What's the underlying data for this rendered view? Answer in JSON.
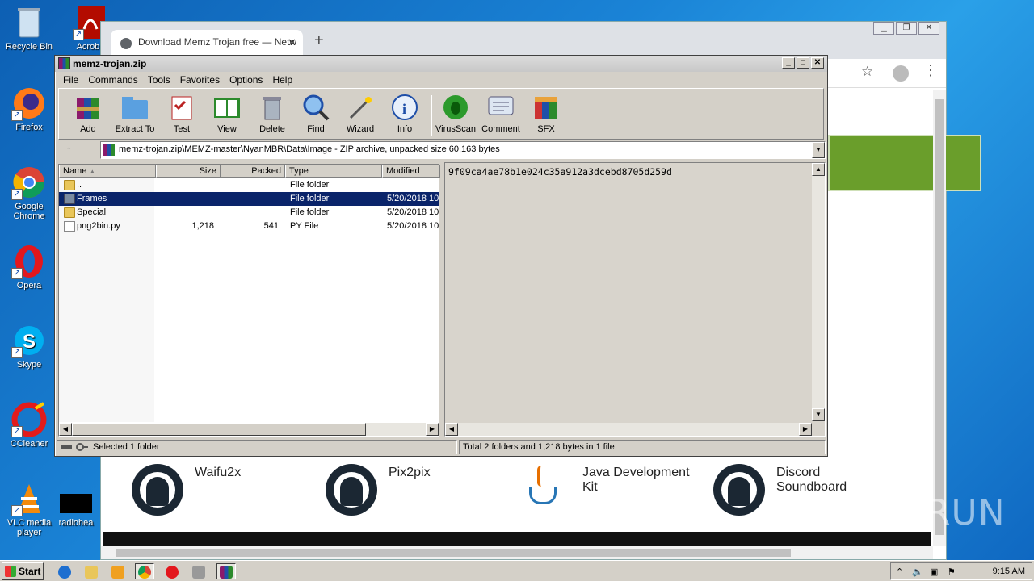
{
  "desktop": {
    "icons": [
      {
        "label": "Recycle Bin"
      },
      {
        "label": "Acroba"
      },
      {
        "label": "Firefox"
      },
      {
        "label": "Google Chrome"
      },
      {
        "label": "Opera"
      },
      {
        "label": "Skype"
      },
      {
        "label": "CCleaner"
      },
      {
        "label": "VLC media player"
      },
      {
        "label": "radiohea"
      }
    ]
  },
  "browser": {
    "tab_title": "Download Memz Trojan free — Netw",
    "features": [
      {
        "label": "Waifu2x",
        "icon": "github-icon"
      },
      {
        "label": "Pix2pix",
        "icon": "github-icon"
      },
      {
        "label": "Java Development Kit",
        "icon": "java-icon"
      },
      {
        "label": "Discord Soundboard",
        "icon": "github-icon"
      }
    ]
  },
  "winrar": {
    "title": "memz-trojan.zip",
    "menu": [
      "File",
      "Commands",
      "Tools",
      "Favorites",
      "Options",
      "Help"
    ],
    "tools": [
      {
        "label": "Add"
      },
      {
        "label": "Extract To"
      },
      {
        "label": "Test"
      },
      {
        "label": "View"
      },
      {
        "label": "Delete"
      },
      {
        "label": "Find"
      },
      {
        "label": "Wizard"
      },
      {
        "label": "Info"
      },
      {
        "label": "VirusScan"
      },
      {
        "label": "Comment"
      },
      {
        "label": "SFX"
      }
    ],
    "path": "memz-trojan.zip\\MEMZ-master\\NyanMBR\\Data\\Image - ZIP archive, unpacked size 60,163 bytes",
    "columns": {
      "name": "Name",
      "size": "Size",
      "packed": "Packed",
      "type": "Type",
      "modified": "Modified"
    },
    "rows": [
      {
        "name": "..",
        "size": "",
        "packed": "",
        "type": "File folder",
        "modified": ""
      },
      {
        "name": "Frames",
        "size": "",
        "packed": "",
        "type": "File folder",
        "modified": "5/20/2018 10"
      },
      {
        "name": "Special",
        "size": "",
        "packed": "",
        "type": "File folder",
        "modified": "5/20/2018 10"
      },
      {
        "name": "png2bin.py",
        "size": "1,218",
        "packed": "541",
        "type": "PY File",
        "modified": "5/20/2018 10"
      }
    ],
    "preview_text": "9f09ca4ae78b1e024c35a912a3dcebd8705d259d",
    "status_left": "Selected 1 folder",
    "status_right": "Total 2 folders and 1,218 bytes in 1 file"
  },
  "watermark": "ANY RUN",
  "taskbar": {
    "start_label": "Start",
    "clock": "9:15 AM"
  }
}
